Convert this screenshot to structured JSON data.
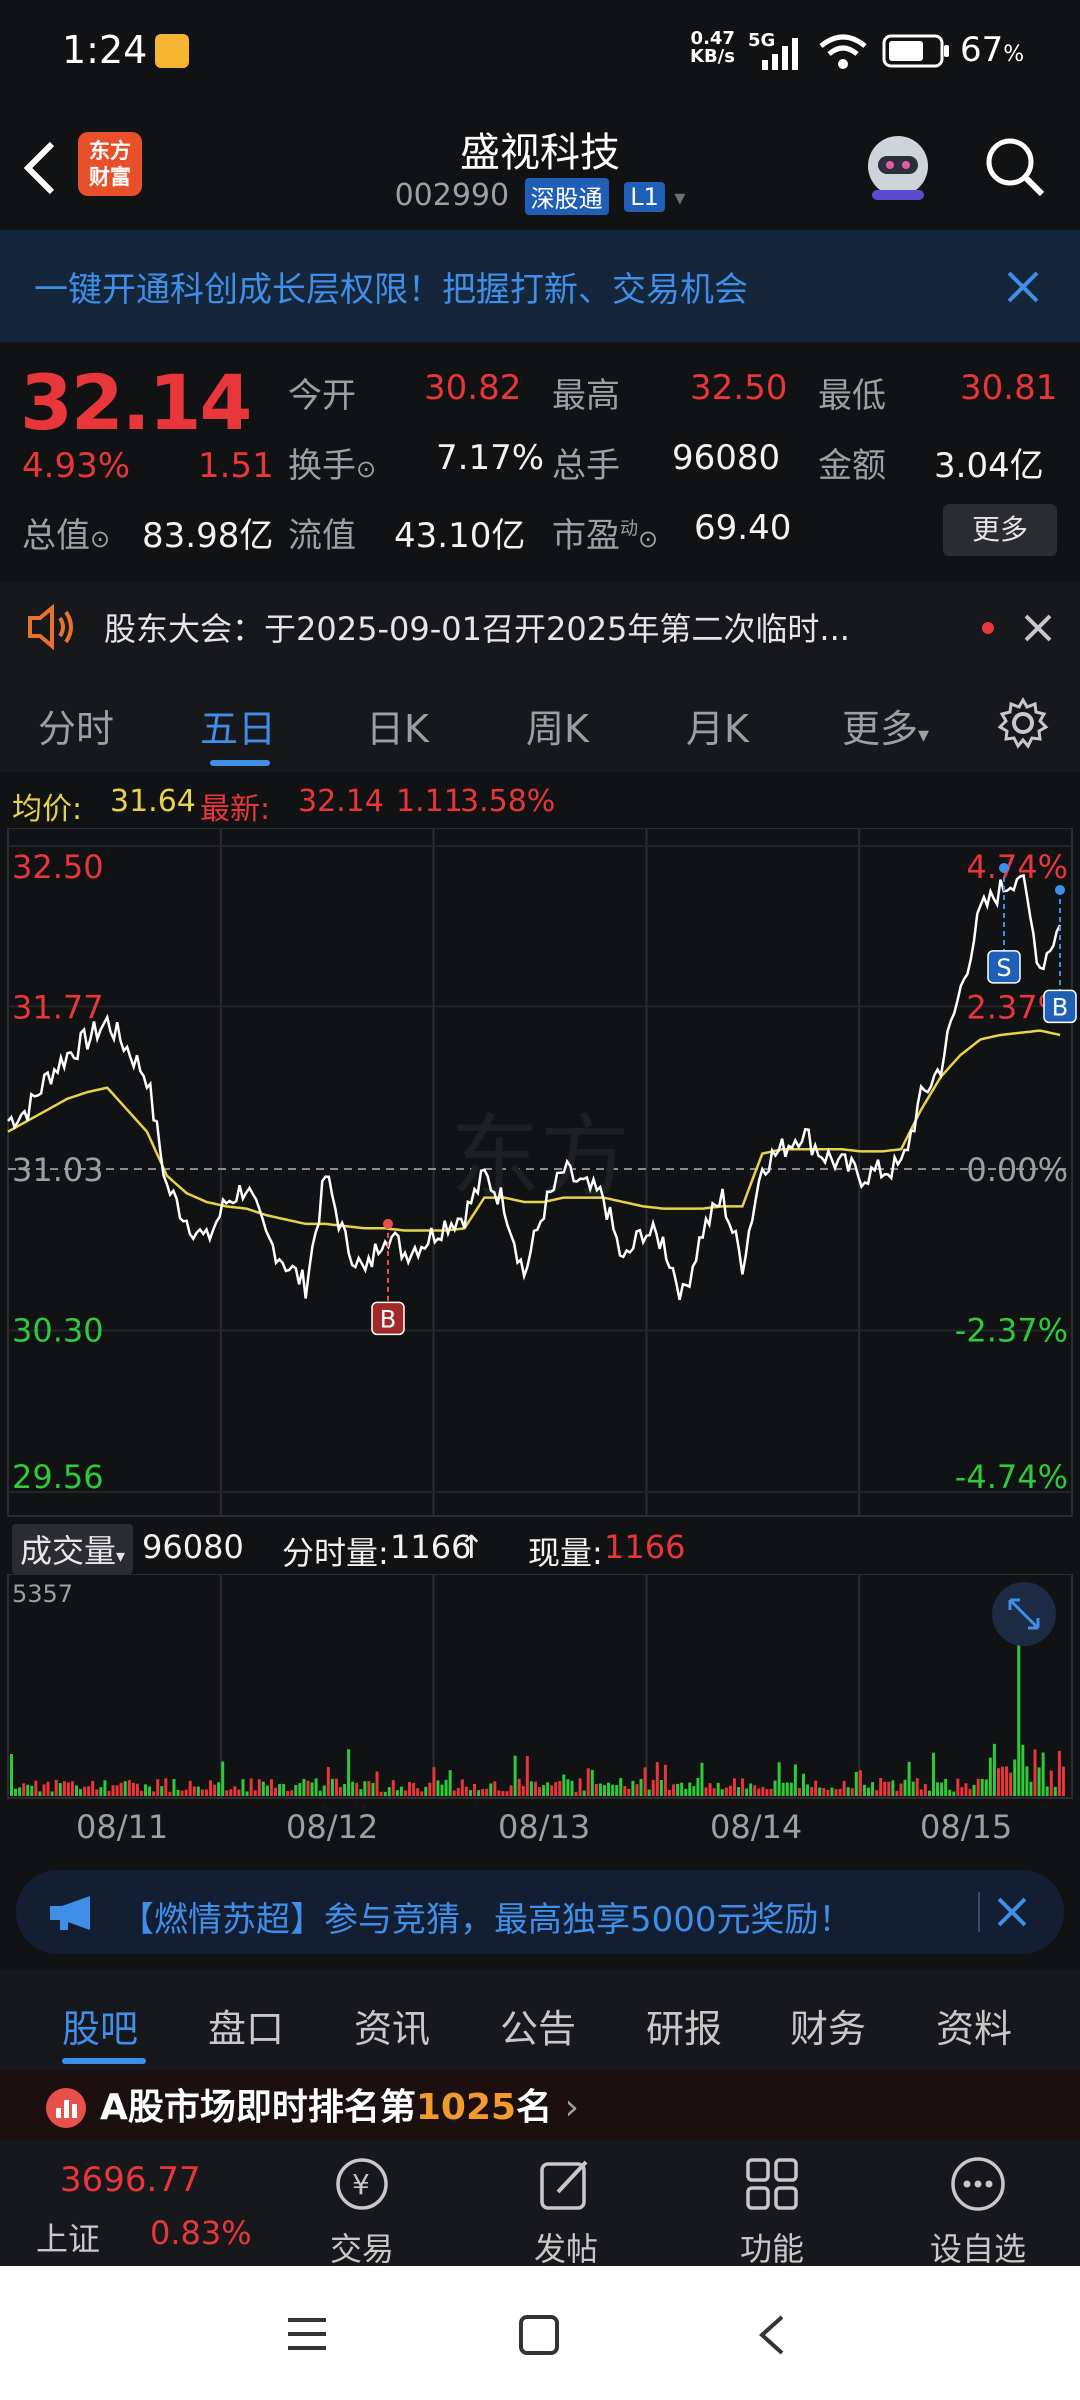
{
  "status_bar": {
    "time": "1:24",
    "net_speed": "0.47",
    "net_unit": "KB/s",
    "network": "5G",
    "battery": "67",
    "battery_unit": "%"
  },
  "header": {
    "title": "盛视科技",
    "code": "002990",
    "exchange_tag": "深股通",
    "level_tag": "L1",
    "logo_text_1": "东方",
    "logo_text_2": "财富"
  },
  "promo": {
    "text": "一键开通科创成长层权限！把握打新、交易机会"
  },
  "quote": {
    "price": "32.14",
    "change_pct": "4.93%",
    "change": "1.51",
    "open_label": "今开",
    "open": "30.82",
    "high_label": "最高",
    "high": "32.50",
    "low_label": "最低",
    "low": "30.81",
    "turnover_label": "换手",
    "turnover": "7.17%",
    "volume_label": "总手",
    "volume": "96080",
    "amount_label": "金额",
    "amount": "3.04亿",
    "mktcap_label": "总值",
    "mktcap": "83.98亿",
    "float_label": "流值",
    "float": "43.10亿",
    "pe_label": "市盈",
    "pe_sup": "动",
    "pe": "69.40",
    "more": "更多"
  },
  "notice": {
    "text": "股东大会：于2025-09-01召开2025年第二次临时..."
  },
  "tabs": [
    "分时",
    "五日",
    "日K",
    "周K",
    "月K",
    "更多"
  ],
  "avg_line": {
    "avg_label": "均价:",
    "avg": "31.64",
    "latest_label": "最新:",
    "latest": "32.14",
    "chg": "1.11",
    "chg_pct": "3.58%"
  },
  "chart_data": {
    "type": "line",
    "y_ticks_left": [
      "32.50",
      "31.77",
      "31.03",
      "30.30",
      "29.56"
    ],
    "y_ticks_right": [
      "4.74%",
      "2.37%",
      "0.00%",
      "-2.37%",
      "-4.74%"
    ],
    "x": [
      "08/11",
      "08/12",
      "08/13",
      "08/14",
      "08/15"
    ],
    "ylim": [
      29.56,
      32.5
    ],
    "prev_close": 31.03,
    "series": [
      {
        "name": "price",
        "values": [
          31.25,
          31.3,
          31.45,
          31.55,
          31.62,
          31.7,
          31.58,
          31.45,
          30.95,
          30.8,
          30.7,
          30.88,
          30.95,
          30.72,
          30.6,
          30.5,
          31.0,
          30.7,
          30.55,
          30.75,
          30.65,
          30.7,
          30.78,
          30.82,
          31.0,
          30.88,
          30.55,
          30.85,
          31.02,
          30.95,
          30.9,
          30.6,
          30.75,
          30.7,
          30.45,
          30.75,
          30.9,
          30.6,
          31.05,
          31.12,
          31.2,
          31.1,
          31.05,
          31.0,
          31.02,
          31.04,
          31.35,
          31.5,
          31.85,
          32.2,
          32.3,
          32.38,
          31.95,
          32.14
        ]
      },
      {
        "name": "avg",
        "values": [
          31.2,
          31.25,
          31.3,
          31.35,
          31.38,
          31.4,
          31.3,
          31.2,
          31.0,
          30.92,
          30.88,
          30.86,
          30.85,
          30.82,
          30.8,
          30.78,
          30.78,
          30.77,
          30.76,
          30.76,
          30.75,
          30.75,
          30.75,
          30.76,
          30.9,
          30.9,
          30.88,
          30.88,
          30.9,
          30.9,
          30.9,
          30.88,
          30.86,
          30.85,
          30.85,
          30.85,
          30.86,
          30.86,
          31.1,
          31.12,
          31.12,
          31.12,
          31.12,
          31.11,
          31.11,
          31.12,
          31.3,
          31.45,
          31.55,
          31.62,
          31.64,
          31.65,
          31.66,
          31.64
        ]
      }
    ],
    "volume_max_label": "5357",
    "trade_marks": [
      "B",
      "S",
      "B"
    ]
  },
  "volume_header": {
    "label": "成交量",
    "total": "96080",
    "tick_label": "分时量:",
    "tick": "1166",
    "tick_arrow": "↑",
    "now_label": "现量:",
    "now": "1166"
  },
  "ad": {
    "text": "【燃情苏超】参与竞猜，最高独享5000元奖励！"
  },
  "section_tabs": [
    "股吧",
    "盘口",
    "资讯",
    "公告",
    "研报",
    "财务",
    "资料"
  ],
  "rank": {
    "text_pre": "A股市场即时排名第",
    "rank": "1025",
    "text_post": "名"
  },
  "bottom_nav": {
    "index_value": "3696.77",
    "index_name": "上证",
    "index_pct": "0.83%",
    "items": [
      "交易",
      "发帖",
      "功能",
      "设自选"
    ]
  },
  "colors": {
    "up": "#e8363a",
    "down": "#2fc93a",
    "accent": "#3f8ee8",
    "price_line": "#ffffff",
    "avg_line": "#e8d24a"
  }
}
